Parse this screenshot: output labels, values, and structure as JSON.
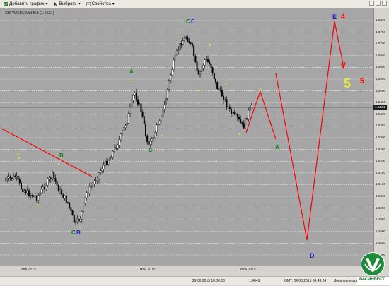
{
  "toolbar": {
    "add_chart": "Добавить график",
    "select": "Выбрать",
    "properties": "Свойства"
  },
  "chart": {
    "symbol_label": "GBP/USD | Mid Bid (1.5521)",
    "current_price": "1.5521",
    "y_ticks": [
      "1.5800",
      "1.5750",
      "1.5700",
      "1.5650",
      "1.5600",
      "1.5550",
      "1.5500",
      "1.5450",
      "1.5400",
      "1.5350",
      "1.5300",
      "1.5250",
      "1.5200",
      "1.5150",
      "1.5100",
      "1.5050",
      "1.5000",
      "1.4950",
      "1.4900",
      "1.4850",
      "1.4800",
      "1.4750"
    ],
    "x_ticks": [
      "апр 2015",
      "май 2015",
      "июн 2015"
    ],
    "wave_labels": {
      "small_a1": "A",
      "small_b1": "B",
      "c_green": "C",
      "b_blue": "B",
      "green_a2": "A",
      "green_b2": "B",
      "c_top_green": "C",
      "c_top_blue": "C",
      "green_a3": "A",
      "e_blue": "E",
      "four_red": "4",
      "five_yellow": "5",
      "five_red": "5",
      "d_blue": "D"
    },
    "colors": {
      "background": "#a6a6a6",
      "candles": "#000000",
      "trendline": "#ff0000",
      "label_green": "#0a7d0a",
      "label_blue": "#1a1adf",
      "label_yellow": "#e8e83a",
      "label_red": "#ff0000"
    }
  },
  "status": {
    "date_cursor": "29.06.2015 10:00:00",
    "price_cursor": "1.4849",
    "gmt": "GMT: 04.06.2015 04:49:24",
    "local": "Локальное вре"
  },
  "logo": {
    "text": "ВАСИНВЕСТ"
  }
}
